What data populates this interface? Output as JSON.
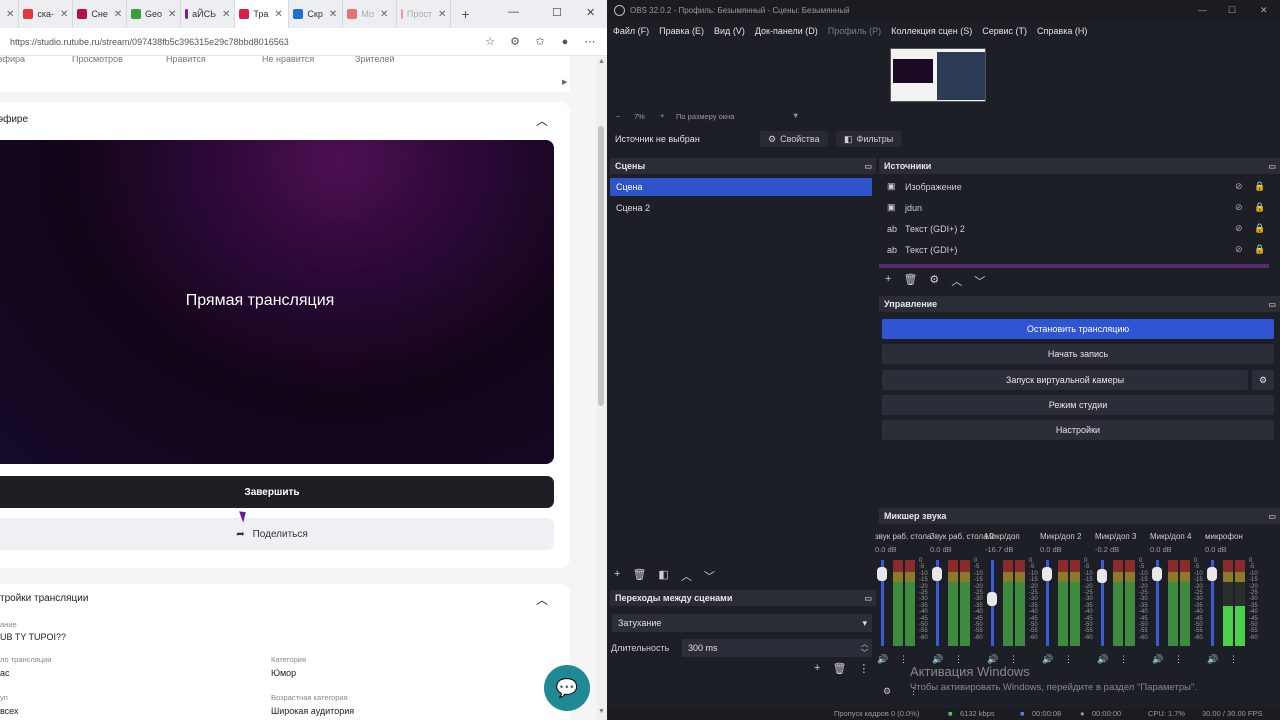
{
  "browser": {
    "tabs": [
      {
        "label": "ска-",
        "color": "#e53935"
      },
      {
        "label": "Сне",
        "color": "#b0124b"
      },
      {
        "label": "Geo",
        "color": "#3aa03a"
      },
      {
        "label": "аЙСЬ",
        "color": "#7a1f9a"
      },
      {
        "label": "Тра",
        "color": "#d61f4b",
        "active": true
      },
      {
        "label": "Скр",
        "color": "#1e6fd9"
      },
      {
        "label": "Мо",
        "color": "#e57373",
        "dim": true
      },
      {
        "label": "Прост",
        "color": "#ef9a9a",
        "dim": true
      }
    ],
    "tab_add": "+",
    "url": "https://studio.rutube.ru/stream/097438fb5c396315e29c78bbd8016563",
    "window_controls": {
      "minimize": "—",
      "maximize": "☐",
      "close": "✕"
    }
  },
  "page": {
    "stats_labels": [
      "эфира",
      "Просмотров",
      "Нравится",
      "Не нравится",
      "Зрителей"
    ],
    "air_section_title": "эфире",
    "preview_title": "Прямая трансляция",
    "end_button": "Завершить",
    "share_button": "Поделиться",
    "settings_section_title": "тройки трансляции",
    "fields": {
      "title_label": "ание",
      "title_value": "UB TY TUPOI??",
      "type_label": "ло трансляции",
      "type_value": "ас",
      "category_label": "Категория",
      "category_value": "Юмор",
      "access_label": "уп",
      "access_value": "всех",
      "age_label": "Возрастная категория",
      "age_value": "Широкая аудитория"
    }
  },
  "obs": {
    "title": "OBS 32.0.2 - Профиль: Безымянный - Сцены: Безымянный",
    "menu": [
      {
        "label": "Файл (F)"
      },
      {
        "label": "Правка (E)"
      },
      {
        "label": "Вид (V)"
      },
      {
        "label": "Док-панели (D)"
      },
      {
        "label": "Профиль (P)",
        "dim": true
      },
      {
        "label": "Коллекция сцен (S)"
      },
      {
        "label": "Сервис (T)"
      },
      {
        "label": "Справка (H)"
      }
    ],
    "zoom": {
      "minus": "−",
      "value": "7%",
      "plus": "+",
      "mode": "По размеру окна"
    },
    "no_source": "Источник не выбран",
    "properties_button": "Свойства",
    "filters_button": "Фильтры",
    "scenes_title": "Сцены",
    "scenes": [
      {
        "name": "Сцена",
        "selected": true
      },
      {
        "name": "Сцена 2",
        "selected": false
      }
    ],
    "sources_title": "Источники",
    "sources": [
      {
        "name": "Изображение",
        "icon": "image-icon"
      },
      {
        "name": "jdun",
        "icon": "image-icon"
      },
      {
        "name": "Текст (GDI+) 2",
        "icon": "text-icon"
      },
      {
        "name": "Текст (GDI+)",
        "icon": "text-icon"
      }
    ],
    "controls_title": "Управление",
    "controls": {
      "stop_stream": "Остановить трансляцию",
      "start_record": "Начать запись",
      "virtual_cam": "Запуск виртуальной камеры",
      "studio_mode": "Режим студии",
      "settings": "Настройки"
    },
    "transitions_title": "Переходы между сценами",
    "transition": "Затухание",
    "duration_label": "Длительность",
    "duration_value": "300 ms",
    "mixer_title": "Микшер звука",
    "mixer": [
      {
        "name": "звук раб. стола",
        "db": "0.0 dB",
        "level": 0.9
      },
      {
        "name": "Звук раб. стола 2",
        "db": "0.0 dB",
        "level": 0.9
      },
      {
        "name": "Микр/доп",
        "db": "-16.7 dB",
        "level": 0.55
      },
      {
        "name": "Микр/доп 2",
        "db": "0.0 dB",
        "level": 0.9
      },
      {
        "name": "Микр/доп 3",
        "db": "-0.2 dB",
        "level": 0.88
      },
      {
        "name": "Микр/доп 4",
        "db": "0.0 dB",
        "level": 0.9
      },
      {
        "name": "микрофон",
        "db": "0.0 dB",
        "level": 0.9
      }
    ],
    "mixer_scale": [
      "0",
      "-5",
      "-10",
      "-15",
      "-20",
      "-25",
      "-30",
      "-35",
      "-40",
      "-45",
      "-50",
      "-55",
      "-60"
    ],
    "activate_windows": "Активация Windows",
    "activate_windows_sub": "Чтобы активировать Windows, перейдите в раздел \"Параметры\".",
    "status": {
      "dropped": "Пропуск кадров 0 (0.0%)",
      "bitrate": "6132 kbps",
      "stream_time": "00:00:08",
      "record_time": "00:00:00",
      "cpu": "CPU: 1.7%",
      "fps": "30.00 / 30.00 FPS"
    }
  }
}
